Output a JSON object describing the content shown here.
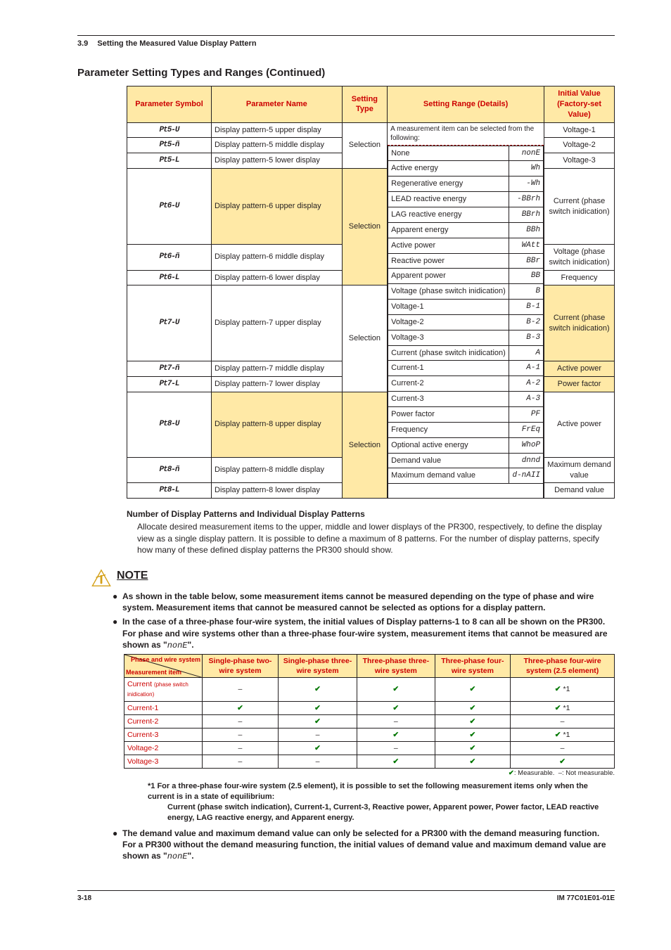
{
  "header": {
    "section_num": "3.9",
    "section_title": "Setting the Measured Value Display Pattern"
  },
  "h2": "Parameter Setting Types and Ranges (Continued)",
  "th": {
    "c1": "Parameter Symbol",
    "c2": "Parameter Name",
    "c3": "Setting Type",
    "c4": "Setting Range (Details)",
    "c5": "Initial Value (Factory-set Value)"
  },
  "rows": [
    {
      "sym": "Pt5-U",
      "name": "Display pattern-5 upper display",
      "type": "Selection",
      "iv": "Voltage-1"
    },
    {
      "sym": "Pt5-ñ",
      "name": "Display pattern-5 middle display",
      "type": "",
      "iv": "Voltage-2"
    },
    {
      "sym": "Pt5-L",
      "name": "Display pattern-5 lower display",
      "type": "",
      "iv": "Voltage-3"
    },
    {
      "sym": "Pt6-U",
      "name": "Display pattern-6 upper display",
      "type": "Selection",
      "type_y": true,
      "iv": "Current (phase switch inidication)"
    },
    {
      "sym": "Pt6-ñ",
      "name": "Display pattern-6 middle display",
      "type": "",
      "iv": "Voltage (phase switch inidication)"
    },
    {
      "sym": "Pt6-L",
      "name": "Display pattern-6 lower display",
      "type": "",
      "iv": "Frequency"
    },
    {
      "sym": "Pt7-U",
      "name": "Display pattern-7 upper display",
      "type": "Selection",
      "iv": "Current (phase switch inidication)",
      "iv_y": true
    },
    {
      "sym": "Pt7-ñ",
      "name": "Display pattern-7 middle display",
      "type": "",
      "iv": "Active power",
      "iv_y": true
    },
    {
      "sym": "Pt7-L",
      "name": "Display pattern-7 lower display",
      "type": "",
      "iv": "Power factor",
      "iv_y": true
    },
    {
      "sym": "Pt8-U",
      "name": "Display pattern-8 upper display",
      "type": "Selection",
      "type_y": true,
      "iv": "Active power"
    },
    {
      "sym": "Pt8-ñ",
      "name": "Display pattern-8 middle display",
      "type": "",
      "iv": "Maximum demand value"
    },
    {
      "sym": "Pt8-L",
      "name": "Display pattern-8 lower display",
      "type": "",
      "iv": "Demand value"
    }
  ],
  "range_intro": "A measurement item can be selected from the following:",
  "range_items": [
    {
      "l": "None",
      "s": "nonE"
    },
    {
      "l": "Active energy",
      "s": "Wh"
    },
    {
      "l": "Regenerative energy",
      "s": "-Wh"
    },
    {
      "l": "LEAD reactive energy",
      "s": "-BBrh"
    },
    {
      "l": "LAG reactive energy",
      "s": "BBrh"
    },
    {
      "l": "Apparent energy",
      "s": "BBh"
    },
    {
      "l": "Active power",
      "s": "WAtt"
    },
    {
      "l": "Reactive power",
      "s": "BBr"
    },
    {
      "l": "Apparent power",
      "s": "BB"
    },
    {
      "l": "Voltage (phase switch inidication)",
      "s": "B"
    },
    {
      "l": "Voltage-1",
      "s": "B-1"
    },
    {
      "l": "Voltage-2",
      "s": "B-2"
    },
    {
      "l": "Voltage-3",
      "s": "B-3"
    },
    {
      "l": "Current (phase switch inidication)",
      "s": "A"
    },
    {
      "l": "Current-1",
      "s": "A-1"
    },
    {
      "l": "Current-2",
      "s": "A-2"
    },
    {
      "l": "Current-3",
      "s": "A-3"
    },
    {
      "l": "Power factor",
      "s": "PF"
    },
    {
      "l": "Frequency",
      "s": "FrEq"
    },
    {
      "l": "Optional active energy",
      "s": "WhoP"
    },
    {
      "l": "Demand value",
      "s": "dnnd"
    },
    {
      "l": "Maximum demand value",
      "s": "d-nAII"
    }
  ],
  "para_h": "Number of Display Patterns and Individual Display Patterns",
  "para_b": "Allocate desired measurement items to the upper, middle and lower displays of the PR300, respectively, to define the display view as a single display pattern. It is possible to define a maximum of 8 patterns. For the number of display patterns, specify how many of these defined display patterns the PR300 should show.",
  "note_label": "NOTE",
  "bullets": [
    "As shown in the table below, some measurement items cannot be measured depending on the type of phase and wire system. Measurement items that cannot be measured cannot be selected as options for a display pattern.",
    "In the case of a three-phase four-wire system, the initial values of Display patterns-1 to 8 can all be shown on the PR300. For phase and wire systems other than a three-phase four-wire system, measurement items that cannot be measured are shown as \""
  ],
  "none_seg": "nonE",
  "meas_header": {
    "diag1": "Phase and wire system",
    "diag2": "Measurement item",
    "c1": "Single-phase two-wire system",
    "c2": "Single-phase three-wire system",
    "c3": "Three-phase three-wire system",
    "c4": "Three-phase four-wire system",
    "c5": "Three-phase four-wire system (2.5 element)"
  },
  "meas_rows": [
    {
      "l": "Current",
      "sub": "(phase switch inidication)",
      "v": [
        "–",
        "✔",
        "✔",
        "✔",
        "✔ *1"
      ]
    },
    {
      "l": "Current-1",
      "v": [
        "✔",
        "✔",
        "✔",
        "✔",
        "✔ *1"
      ]
    },
    {
      "l": "Current-2",
      "v": [
        "–",
        "✔",
        "–",
        "✔",
        "–"
      ]
    },
    {
      "l": "Current-3",
      "v": [
        "–",
        "–",
        "✔",
        "✔",
        "✔ *1"
      ]
    },
    {
      "l": "Voltage-2",
      "v": [
        "–",
        "✔",
        "–",
        "✔",
        "–"
      ]
    },
    {
      "l": "Voltage-3",
      "v": [
        "–",
        "–",
        "✔",
        "✔",
        "✔"
      ]
    }
  ],
  "legend": "✔: Measurable.  –: Not measurable.",
  "foot1": "*1   For a three-phase four-wire system (2.5 element), it is possible to set the following measurement items only when the current is in a state of equilibrium:",
  "foot1b": "Current (phase switch indication), Current-1, Current-3, Reactive power, Apparent power, Power factor, LEAD reactive energy, LAG reactive energy, and Apparent energy.",
  "bullet3": "The demand value and maximum demand value can only be selected for a PR300 with the demand measuring function. For a PR300 without the demand measuring function, the initial values of demand value and maximum demand value are shown as  \"",
  "footer": {
    "l": "3-18",
    "r": "IM 77C01E01-01E"
  }
}
